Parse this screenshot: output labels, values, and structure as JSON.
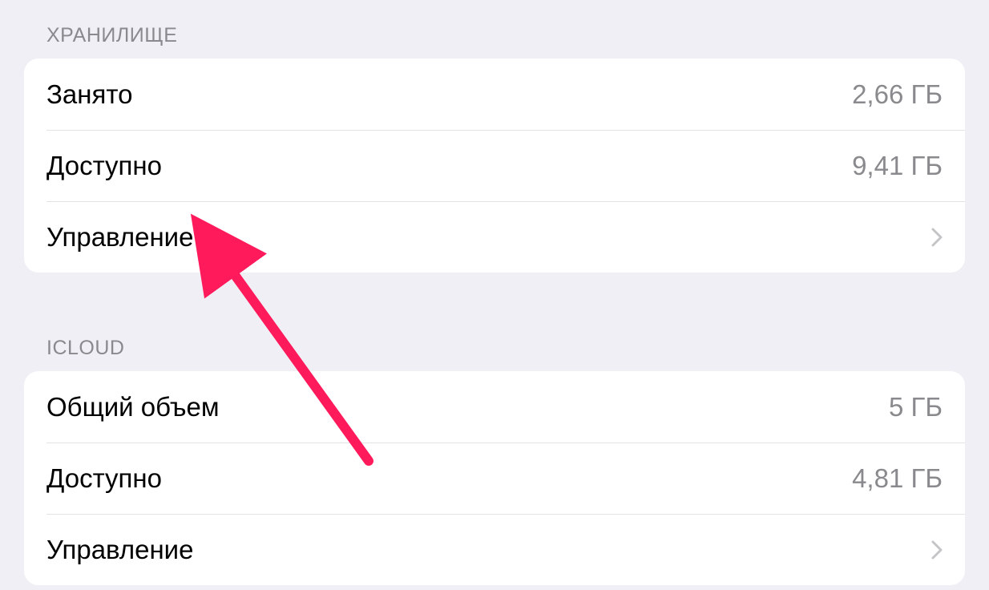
{
  "sections": {
    "storage": {
      "header": "ХРАНИЛИЩЕ",
      "rows": {
        "used": {
          "label": "Занято",
          "value": "2,66 ГБ"
        },
        "available": {
          "label": "Доступно",
          "value": "9,41 ГБ"
        },
        "manage": {
          "label": "Управление"
        }
      }
    },
    "icloud": {
      "header": "ICLOUD",
      "rows": {
        "total": {
          "label": "Общий объем",
          "value": "5 ГБ"
        },
        "available": {
          "label": "Доступно",
          "value": "4,81 ГБ"
        },
        "manage": {
          "label": "Управление"
        }
      }
    }
  },
  "annotation": {
    "arrow_color": "#ff1a5b"
  }
}
